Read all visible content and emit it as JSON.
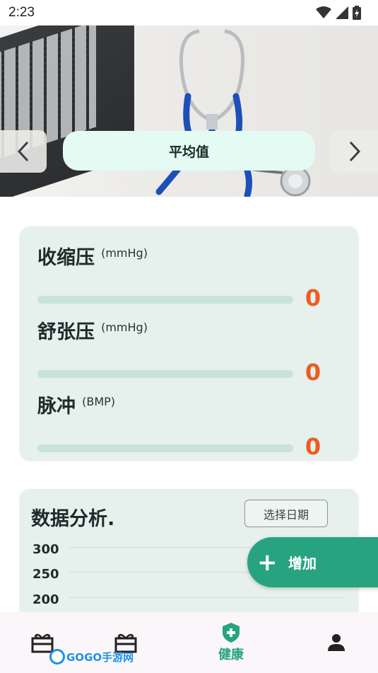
{
  "status_bar": {
    "time": "2:23",
    "icons": [
      "wifi-icon",
      "signal-icon",
      "battery-charging-icon"
    ]
  },
  "hero": {
    "average_label": "平均值",
    "prev_icon": "chevron-left-icon",
    "next_icon": "chevron-right-icon"
  },
  "vitals": [
    {
      "label": "收缩压",
      "unit": "(mmHg)",
      "value": "0"
    },
    {
      "label": "舒张压",
      "unit": "(mmHg)",
      "value": "0"
    },
    {
      "label": "脉冲",
      "unit": "(BMP)",
      "value": "0"
    }
  ],
  "analysis": {
    "title": "数据分析.",
    "date_button": "选择日期",
    "y_ticks": [
      "300",
      "250",
      "200"
    ]
  },
  "fab": {
    "label": "增加",
    "icon": "plus-icon"
  },
  "bottom_nav": {
    "items": [
      {
        "icon": "gift-box-icon",
        "label": ""
      },
      {
        "icon": "gift-box-icon",
        "label": ""
      },
      {
        "icon": "health-shield-icon",
        "label": "健康"
      },
      {
        "icon": "person-icon",
        "label": ""
      }
    ]
  },
  "watermark": {
    "text": "GOGO手游网"
  },
  "colors": {
    "accent": "#27a47f",
    "value": "#ee5b21",
    "card_bg": "#e6f0ed",
    "pill_bg": "#e3fbf2"
  }
}
